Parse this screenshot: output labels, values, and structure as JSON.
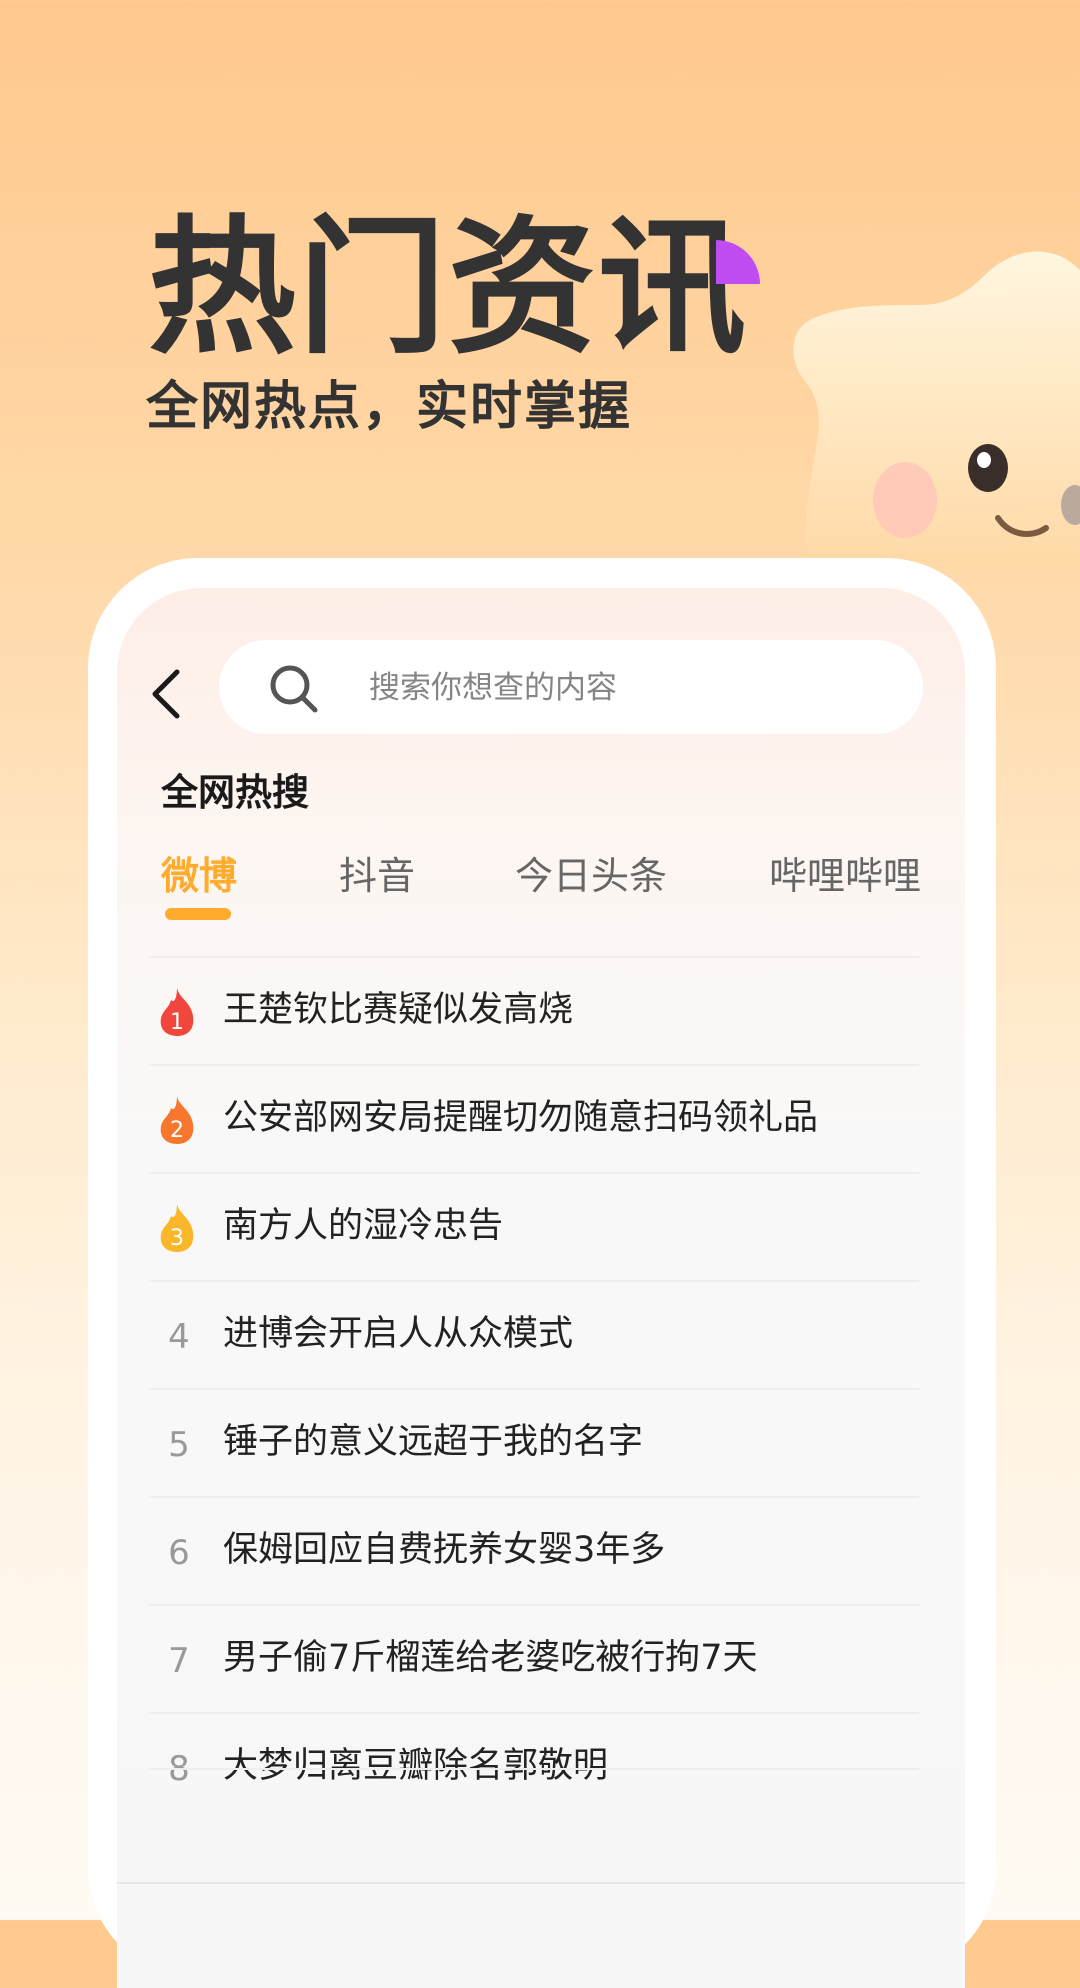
{
  "hero": {
    "title": "热门资讯",
    "subtitle": "全网热点，实时掌握"
  },
  "colors": {
    "accent": "#ffac2e",
    "purple_accent": "#c04df2",
    "rank1": "#f0463c",
    "rank2": "#f7772e",
    "rank3": "#fbb72a"
  },
  "search": {
    "placeholder": "搜索你想查的内容"
  },
  "section": {
    "title": "全网热搜"
  },
  "tabs": [
    {
      "label": "微博",
      "active": true
    },
    {
      "label": "抖音",
      "active": false
    },
    {
      "label": "今日头条",
      "active": false
    },
    {
      "label": "哔哩哔哩",
      "active": false
    }
  ],
  "hot_list": [
    {
      "rank": "1",
      "title": "王楚钦比赛疑似发高烧",
      "badge": "flame-red"
    },
    {
      "rank": "2",
      "title": "公安部网安局提醒切勿随意扫码领礼品",
      "badge": "flame-orange"
    },
    {
      "rank": "3",
      "title": "南方人的湿冷忠告",
      "badge": "flame-yellow"
    },
    {
      "rank": "4",
      "title": "进博会开启人从众模式"
    },
    {
      "rank": "5",
      "title": "锤子的意义远超于我的名字"
    },
    {
      "rank": "6",
      "title": "保姆回应自费抚养女婴3年多"
    },
    {
      "rank": "7",
      "title": "男子偷7斤榴莲给老婆吃被行拘7天"
    },
    {
      "rank": "8",
      "title": "大梦归离豆瓣除名郭敬明"
    }
  ],
  "icons": {
    "back": "chevron-left-icon",
    "search": "search-icon",
    "rank_badge": "flame-icon",
    "mascot": "star-mascot-icon"
  }
}
